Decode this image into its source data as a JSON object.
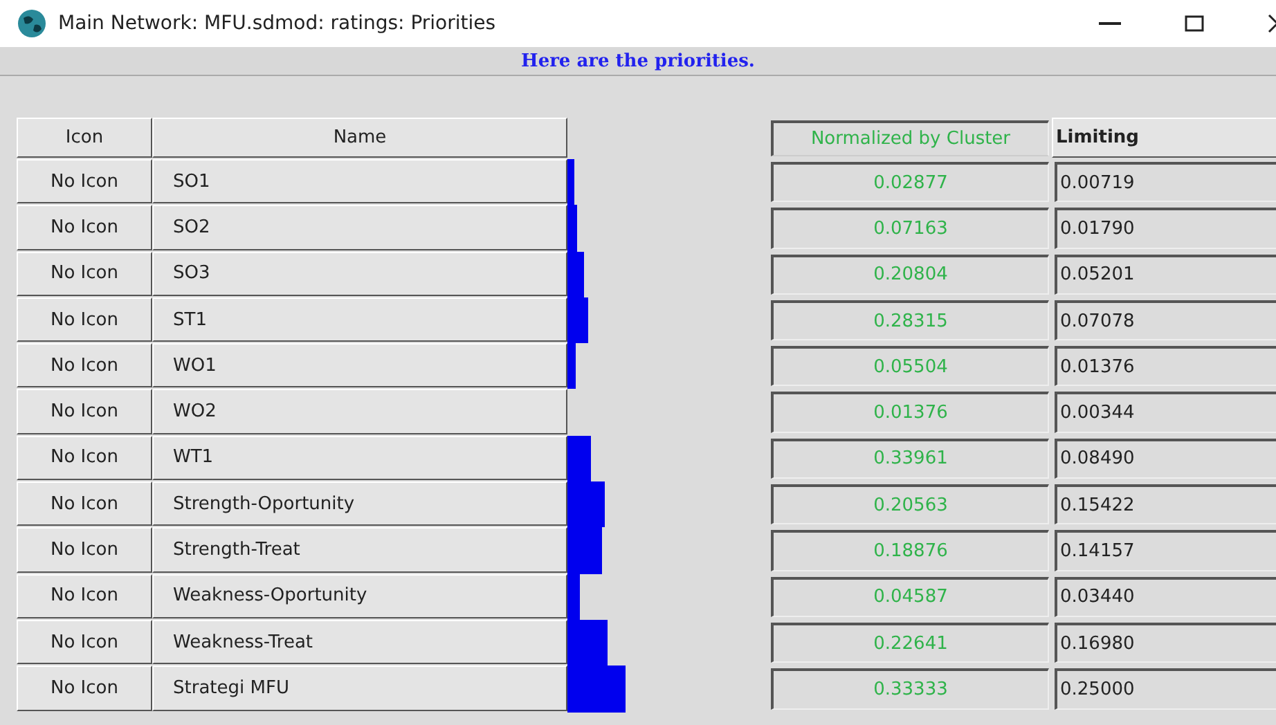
{
  "window": {
    "title": "Main Network: MFU.sdmod: ratings: Priorities"
  },
  "banner": "Here are the priorities.",
  "table": {
    "columns": [
      "Icon",
      "Name",
      "Normalized by Cluster",
      "Limiting"
    ],
    "rows": [
      {
        "icon": "No Icon",
        "name": "SO1",
        "normalized": "0.02877",
        "limiting": "0.00719"
      },
      {
        "icon": "No Icon",
        "name": "SO2",
        "normalized": "0.07163",
        "limiting": "0.01790"
      },
      {
        "icon": "No Icon",
        "name": "SO3",
        "normalized": "0.20804",
        "limiting": "0.05201"
      },
      {
        "icon": "No Icon",
        "name": "ST1",
        "normalized": "0.28315",
        "limiting": "0.07078"
      },
      {
        "icon": "No Icon",
        "name": "WO1",
        "normalized": "0.05504",
        "limiting": "0.01376"
      },
      {
        "icon": "No Icon",
        "name": "WO2",
        "normalized": "0.01376",
        "limiting": "0.00344"
      },
      {
        "icon": "No Icon",
        "name": "WT1",
        "normalized": "0.33961",
        "limiting": "0.08490"
      },
      {
        "icon": "No Icon",
        "name": "Strength-Oportunity",
        "normalized": "0.20563",
        "limiting": "0.15422"
      },
      {
        "icon": "No Icon",
        "name": "Strength-Treat",
        "normalized": "0.18876",
        "limiting": "0.14157"
      },
      {
        "icon": "No Icon",
        "name": "Weakness-Oportunity",
        "normalized": "0.04587",
        "limiting": "0.03440"
      },
      {
        "icon": "No Icon",
        "name": "Weakness-Treat",
        "normalized": "0.22641",
        "limiting": "0.16980"
      },
      {
        "icon": "No Icon",
        "name": "Strategi MFU",
        "normalized": "0.33333",
        "limiting": "0.25000"
      }
    ]
  }
}
